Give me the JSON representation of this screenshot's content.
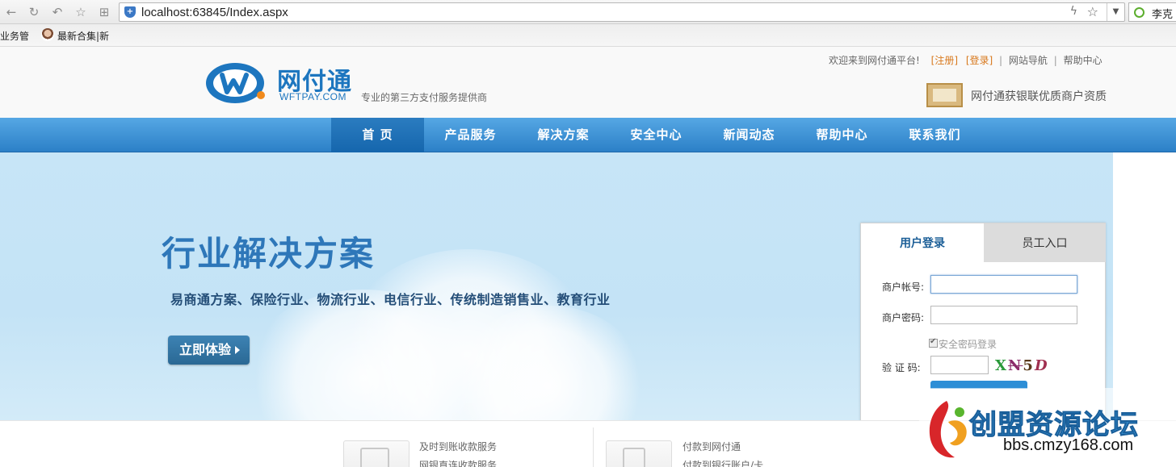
{
  "browser": {
    "url": "localhost:63845/Index.aspx",
    "search_text": "李克",
    "bookmarks": [
      "企业务管",
      "最新合集|新"
    ]
  },
  "header": {
    "logo_cn": "网付通",
    "logo_en": "WFTPAY.COM",
    "slogan": "专业的第三方支付服务提供商",
    "welcome": "欢迎来到网付通平台!",
    "register": "[注册]",
    "login": "[登录]",
    "site_nav": "网站导航",
    "help": "帮助中心",
    "certificate": "网付通获银联优质商户资质"
  },
  "nav": {
    "items": [
      "首  页",
      "产品服务",
      "解决方案",
      "安全中心",
      "新闻动态",
      "帮助中心",
      "联系我们"
    ],
    "active_index": 0
  },
  "banner": {
    "title": "行业解决方案",
    "subtitle": "易商通方案、保险行业、物流行业、电信行业、传统制造销售业、教育行业",
    "button": "立即体验"
  },
  "login_panel": {
    "tab_user": "用户登录",
    "tab_staff": "员工入口",
    "account_label": "商户帐号:",
    "password_label": "商户密码:",
    "secure_label": "安全密码登录",
    "captcha_label": "验 证 码:",
    "captcha_chars": [
      "X",
      "N",
      "5",
      "D"
    ]
  },
  "services": {
    "left": [
      "及时到账收款服务",
      "网银直连收款服务"
    ],
    "right": [
      "付款到网付通",
      "付款到银行账户/卡"
    ]
  },
  "watermark": {
    "title": "创盟资源论坛",
    "url": "bbs.cmzy168.com"
  },
  "colors": {
    "nav_blue": "#2c80c7",
    "banner_bg": "#c7e5f7",
    "accent_orange": "#d8781c"
  }
}
